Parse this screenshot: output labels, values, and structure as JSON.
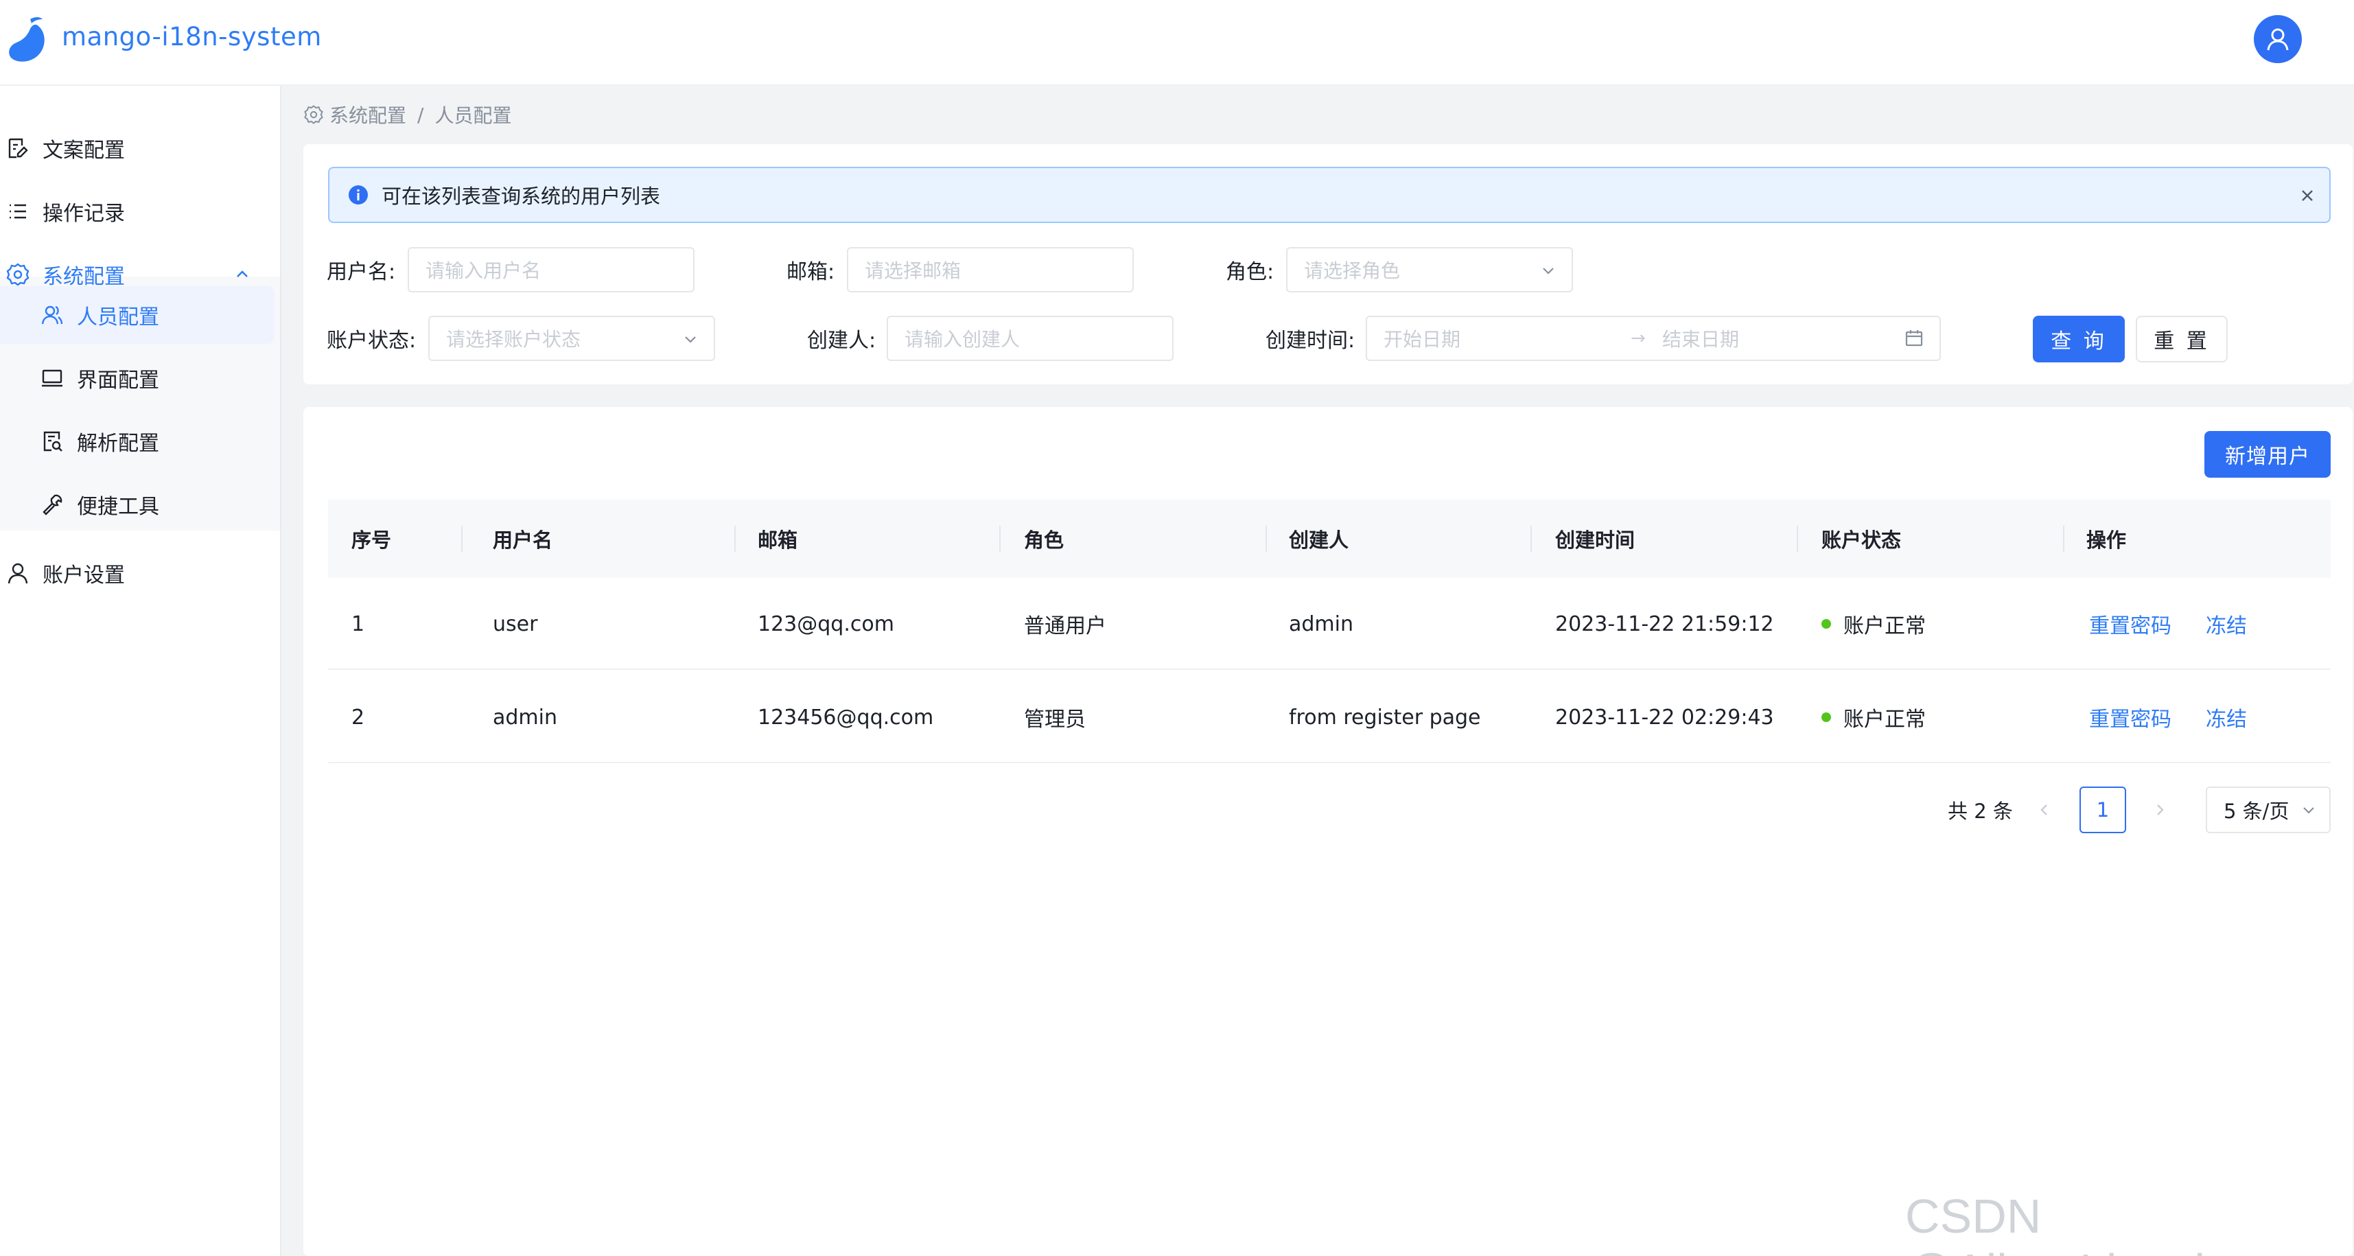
{
  "app": {
    "title": "mango-i18n-system"
  },
  "sidebar": {
    "items": [
      {
        "label": "文案配置"
      },
      {
        "label": "操作记录"
      },
      {
        "label": "系统配置"
      },
      {
        "label": "人员配置"
      },
      {
        "label": "界面配置"
      },
      {
        "label": "解析配置"
      },
      {
        "label": "便捷工具"
      },
      {
        "label": "账户设置"
      }
    ]
  },
  "breadcrumb": {
    "parent": "系统配置",
    "separator": "/",
    "current": "人员配置"
  },
  "alert": {
    "message": "可在该列表查询系统的用户列表"
  },
  "filters": {
    "username": {
      "label": "用户名:",
      "placeholder": "请输入用户名"
    },
    "email": {
      "label": "邮箱:",
      "placeholder": "请选择邮箱"
    },
    "role": {
      "label": "角色:",
      "placeholder": "请选择角色"
    },
    "status": {
      "label": "账户状态:",
      "placeholder": "请选择账户状态"
    },
    "creator": {
      "label": "创建人:",
      "placeholder": "请输入创建人"
    },
    "created_time": {
      "label": "创建时间:",
      "start_placeholder": "开始日期",
      "end_placeholder": "结束日期",
      "arrow": "→"
    },
    "search_label": "查 询",
    "reset_label": "重 置"
  },
  "table": {
    "add_button": "新增用户",
    "columns": [
      "序号",
      "用户名",
      "邮箱",
      "角色",
      "创建人",
      "创建时间",
      "账户状态",
      "操作"
    ],
    "rows": [
      {
        "index": "1",
        "username": "user",
        "email": "123@qq.com",
        "role": "普通用户",
        "creator": "admin",
        "created": "2023-11-22 21:59:12",
        "status": "账户正常",
        "action_reset": "重置密码",
        "action_freeze": "冻结"
      },
      {
        "index": "2",
        "username": "admin",
        "email": "123456@qq.com",
        "role": "管理员",
        "creator": "from register page",
        "created": "2023-11-22 02:29:43",
        "status": "账户正常",
        "action_reset": "重置密码",
        "action_freeze": "冻结"
      }
    ]
  },
  "pagination": {
    "total": "共 2 条",
    "current_page": "1",
    "page_size": "5 条/页"
  },
  "watermark": "CSDN @AlbertLin_shu",
  "colors": {
    "primary": "#2f6ff4",
    "link": "#2e7cf6",
    "status_ok": "#52c41a",
    "alert_bg": "#e8f3ff"
  },
  "icons": [
    "mango-logo-icon",
    "user-avatar-icon",
    "document-edit-icon",
    "list-icon",
    "gear-icon",
    "chevron-up-icon",
    "users-icon",
    "monitor-icon",
    "file-search-icon",
    "wrench-icon",
    "user-icon",
    "info-icon",
    "close-icon",
    "chevron-down-icon",
    "calendar-icon",
    "chevron-left-icon",
    "chevron-right-icon"
  ]
}
